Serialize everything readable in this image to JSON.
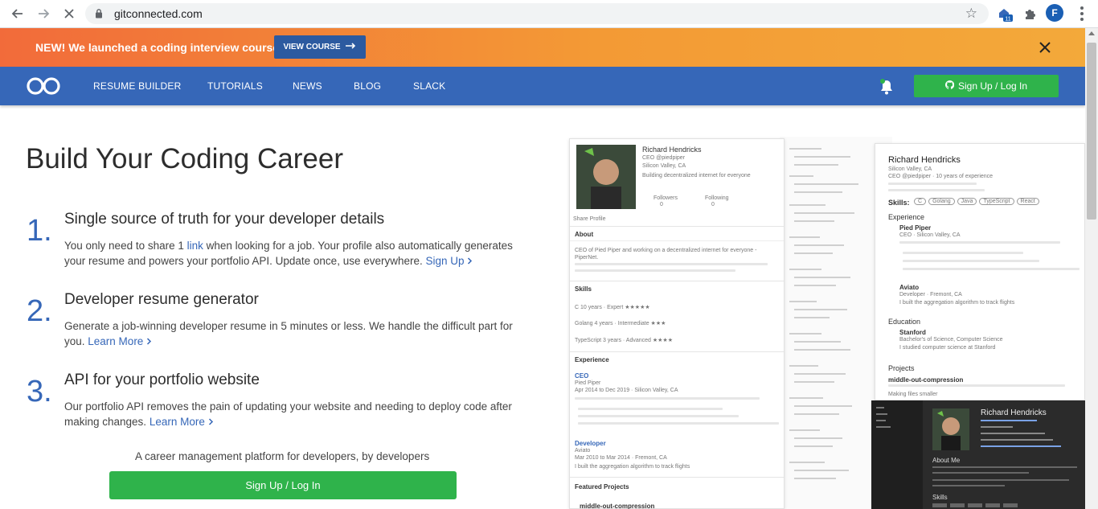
{
  "browser": {
    "url": "gitconnected.com",
    "profile_initial": "F",
    "extension_badge": "11"
  },
  "promo": {
    "text": "NEW! We launched a coding interview course",
    "button_label": "VIEW COURSE"
  },
  "nav": {
    "items": [
      "RESUME BUILDER",
      "TUTORIALS",
      "NEWS",
      "BLOG",
      "SLACK"
    ],
    "signup_label": "Sign Up / Log In"
  },
  "main": {
    "title": "Build Your Coding Career",
    "features": [
      {
        "number": "1.",
        "title": "Single source of truth for your developer details",
        "desc_before": "You only need to share 1 ",
        "desc_link": "link",
        "desc_after": " when looking for a job. Your profile also automatically generates your resume and powers your portfolio API. Update once, use everywhere. ",
        "cta": "Sign Up"
      },
      {
        "number": "2.",
        "title": "Developer resume generator",
        "desc_before": "Generate a job-winning developer resume in 5 minutes or less. We handle the difficult part for you. ",
        "desc_link": "",
        "desc_after": "",
        "cta": "Learn More"
      },
      {
        "number": "3.",
        "title": "API for your portfolio website",
        "desc_before": "Our portfolio API removes the pain of updating your website and needing to deploy code after making changes. ",
        "desc_link": "",
        "desc_after": "",
        "cta": "Learn More"
      }
    ],
    "tagline": "A career management platform for developers, by developers",
    "signup_label": "Sign Up / Log In"
  },
  "preview": {
    "profile": {
      "name": "Richard Hendricks",
      "role": "CEO @piedpiper",
      "location": "Silicon Valley, CA",
      "tagline": "Building decentralized internet for everyone",
      "followers_label": "Followers",
      "followers": "0",
      "following_label": "Following",
      "following": "0",
      "share": "Share Profile",
      "about_h": "About",
      "about_text": "CEO of Pied Piper and working on a decentralized internet for everyone - PiperNet.",
      "skills_h": "Skills",
      "skills": [
        "C 10 years · Expert ★★★★★",
        "Golang 4 years · Intermediate ★★★",
        "TypeScript 3 years · Advanced ★★★★"
      ],
      "experience_h": "Experience",
      "exp1_title": "CEO",
      "exp1_company": "Pied Piper",
      "exp1_dates": "Apr 2014 to Dec 2019 · Silicon Valley, CA",
      "exp2_title": "Developer",
      "exp2_company": "Aviato",
      "exp2_dates": "Mar 2010 to Mar 2014 · Fremont, CA",
      "exp2_desc": "I built the aggregation algorithm to track flights",
      "featured_h": "Featured Projects",
      "featured_1": "middle-out-compression"
    },
    "resume": {
      "name": "Richard Hendricks",
      "location": "Silicon Valley, CA",
      "line1": "CEO @piedpiper · 10 years of experience",
      "skills_h": "Skills:",
      "skills": [
        "C",
        "Golang",
        "Java",
        "TypeScript",
        "React"
      ],
      "experience_h": "Experience",
      "exp1": "Pied Piper",
      "exp1_sub": "CEO · Silicon Valley, CA",
      "exp2": "Aviato",
      "exp2_sub": "Developer · Fremont, CA",
      "exp2_desc": "I built the aggregation algorithm to track flights",
      "education_h": "Education",
      "edu1": "Stanford",
      "edu1_sub": "Bachelor's of Science, Computer Science",
      "edu1_desc": "I studied computer science at Stanford",
      "projects_h": "Projects",
      "proj1": "middle-out-compression",
      "proj1_desc": "Making files smaller"
    },
    "portfolio": {
      "name": "Richard Hendricks",
      "about_h": "About Me",
      "skills_h": "Skills"
    }
  },
  "colors": {
    "accent_blue": "#3667b8",
    "promo_orange": "#f26b3a",
    "green": "#2fb34b"
  }
}
